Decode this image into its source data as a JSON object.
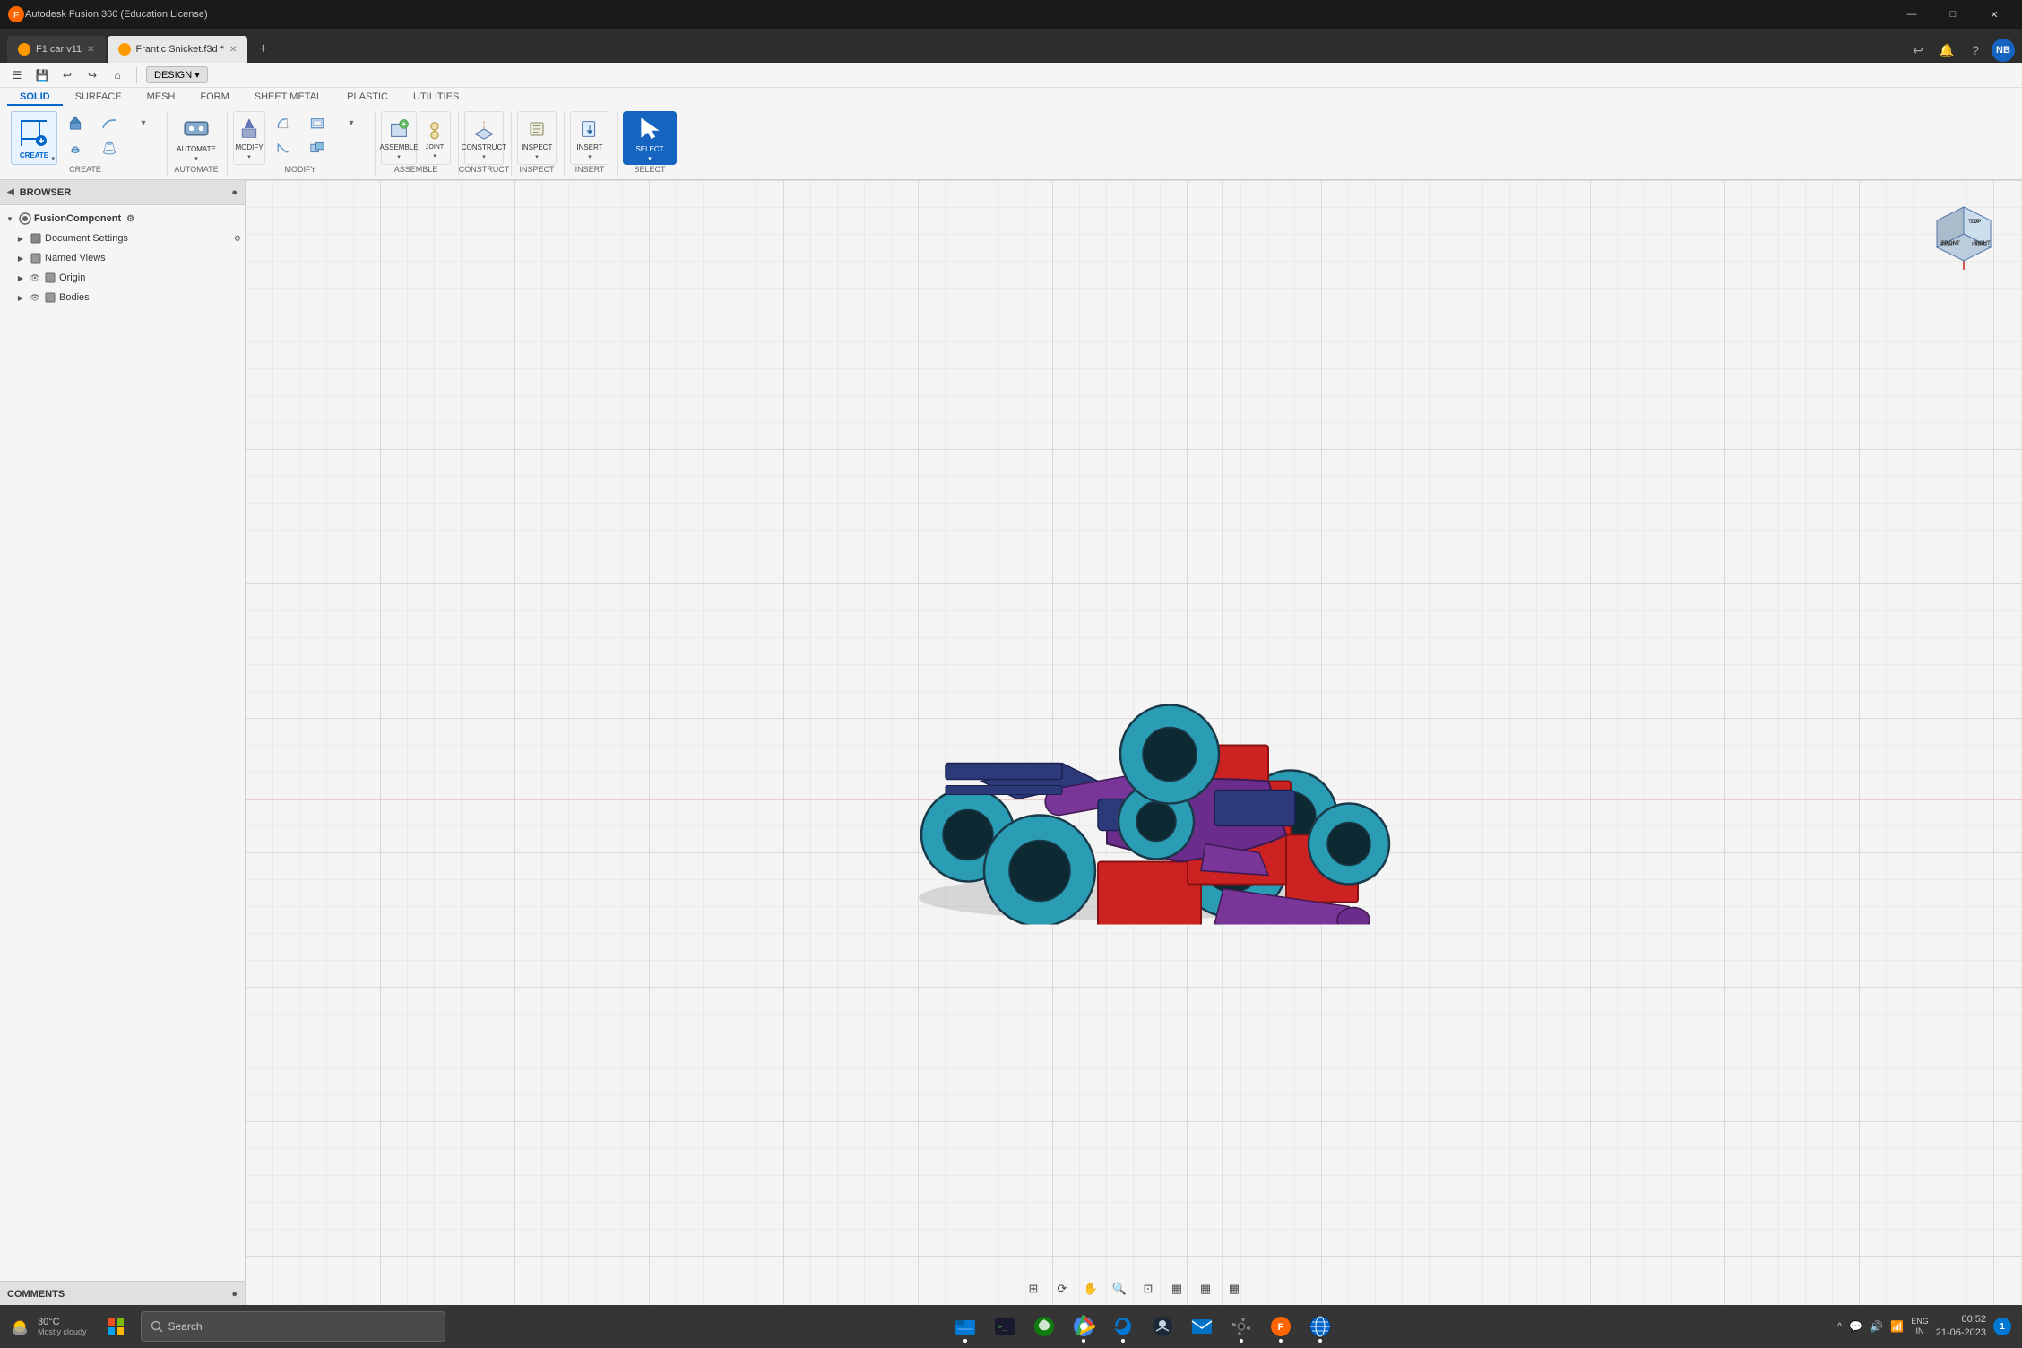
{
  "titlebar": {
    "title": "Autodesk Fusion 360 (Education License)",
    "min_label": "—",
    "max_label": "□",
    "close_label": "✕"
  },
  "tabs": [
    {
      "id": "tab1",
      "label": "F1 car v11",
      "active": false,
      "icon": "orange"
    },
    {
      "id": "tab2",
      "label": "Frantic Snicket.f3d *",
      "active": true,
      "icon": "orange"
    }
  ],
  "tab_toolbar": {
    "add_label": "+",
    "icons": [
      "↩",
      "🔔",
      "❓"
    ],
    "user_initials": "NB"
  },
  "toolbar_top": {
    "quick_actions": [
      "≡",
      "💾",
      "↩",
      "↪",
      "🏠"
    ],
    "design_label": "DESIGN ▾"
  },
  "toolbar_tabs": [
    {
      "label": "SOLID",
      "active": true
    },
    {
      "label": "SURFACE",
      "active": false
    },
    {
      "label": "MESH",
      "active": false
    },
    {
      "label": "FORM",
      "active": false
    },
    {
      "label": "SHEET METAL",
      "active": false
    },
    {
      "label": "PLASTIC",
      "active": false
    },
    {
      "label": "UTILITIES",
      "active": false
    }
  ],
  "ribbon_groups": [
    {
      "label": "CREATE",
      "items": [
        {
          "icon": "create_sketch",
          "label": "",
          "large": true
        },
        {
          "icon": "extrude",
          "label": ""
        },
        {
          "icon": "revolve",
          "label": ""
        },
        {
          "icon": "sweep",
          "label": ""
        },
        {
          "icon": "loft",
          "label": ""
        },
        {
          "icon": "more",
          "label": ""
        }
      ]
    },
    {
      "label": "AUTOMATE",
      "items": [
        {
          "icon": "automate_main",
          "label": "",
          "large": true
        },
        {
          "icon": "automate2",
          "label": ""
        }
      ]
    },
    {
      "label": "MODIFY",
      "items": [
        {
          "icon": "press_pull",
          "label": ""
        },
        {
          "icon": "fillet",
          "label": ""
        },
        {
          "icon": "chamfer",
          "label": ""
        },
        {
          "icon": "shell",
          "label": ""
        },
        {
          "icon": "combine",
          "label": ""
        },
        {
          "icon": "more2",
          "label": ""
        }
      ]
    },
    {
      "label": "ASSEMBLE",
      "items": [
        {
          "icon": "new_component",
          "label": ""
        },
        {
          "icon": "joint",
          "label": ""
        }
      ]
    },
    {
      "label": "CONSTRUCT",
      "items": [
        {
          "icon": "plane",
          "label": ""
        },
        {
          "icon": "axis",
          "label": ""
        }
      ]
    },
    {
      "label": "INSPECT",
      "items": [
        {
          "icon": "measure",
          "label": ""
        },
        {
          "icon": "inspect2",
          "label": ""
        }
      ]
    },
    {
      "label": "INSERT",
      "items": [
        {
          "icon": "insert1",
          "label": ""
        }
      ]
    },
    {
      "label": "SELECT",
      "items": [
        {
          "icon": "select_main",
          "label": "",
          "active": true
        }
      ]
    }
  ],
  "browser": {
    "title": "BROWSER",
    "root_label": "FusionComponent",
    "items": [
      {
        "label": "Document Settings",
        "indent": 1,
        "has_arrow": true,
        "has_gear": true
      },
      {
        "label": "Named Views",
        "indent": 1,
        "has_arrow": true,
        "has_eye": false
      },
      {
        "label": "Origin",
        "indent": 1,
        "has_arrow": true,
        "has_eye": true
      },
      {
        "label": "Bodies",
        "indent": 1,
        "has_arrow": true,
        "has_eye": true
      }
    ]
  },
  "comments": {
    "title": "COMMENTS"
  },
  "viewport": {
    "background_color": "#f0f0f0"
  },
  "viewport_bottom_tools": [
    "⊞",
    "↔",
    "✋",
    "🔍+",
    "🔍",
    "▦",
    "▦▦",
    "▦▦"
  ],
  "taskbar": {
    "start_icon": "⊞",
    "search_placeholder": "Search",
    "weather": {
      "temp": "30°C",
      "condition": "Mostly cloudy"
    },
    "clock": {
      "time": "00:52",
      "date": "21-06-2023"
    },
    "sys_icons": [
      "^",
      "💬",
      "🔊",
      "📶",
      "ENG\nIN"
    ],
    "apps": [
      {
        "name": "explorer",
        "color": "#0078d4",
        "active": false
      },
      {
        "name": "terminal",
        "color": "#4caf50",
        "active": false
      },
      {
        "name": "gamepass",
        "color": "#888",
        "active": false
      },
      {
        "name": "chrome",
        "color": "#ea4335",
        "active": true
      },
      {
        "name": "edge",
        "color": "#0078d4",
        "active": true
      },
      {
        "name": "steam",
        "color": "#1b2838",
        "active": false
      },
      {
        "name": "outlook",
        "color": "#0072c6",
        "active": false
      },
      {
        "name": "settings",
        "color": "#555",
        "active": true
      },
      {
        "name": "fusion",
        "color": "#ff6600",
        "active": true
      },
      {
        "name": "browser2",
        "color": "#0066cc",
        "active": true
      }
    ]
  },
  "viewcube": {
    "top_label": "TOP",
    "front_label": "FRONT",
    "right_label": "RIGHT"
  }
}
